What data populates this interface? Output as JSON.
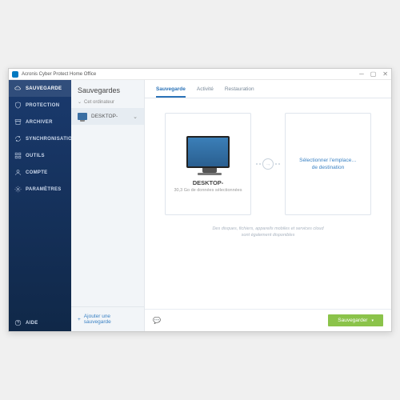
{
  "titlebar": {
    "title": "Acronis Cyber Protect Home Office"
  },
  "sidebar": {
    "items": [
      {
        "label": "SAUVEGARDE",
        "icon": "cloud"
      },
      {
        "label": "PROTECTION",
        "icon": "shield"
      },
      {
        "label": "ARCHIVER",
        "icon": "archive"
      },
      {
        "label": "SYNCHRONISATION",
        "icon": "sync"
      },
      {
        "label": "OUTILS",
        "icon": "grid"
      },
      {
        "label": "COMPTE",
        "icon": "user"
      },
      {
        "label": "PARAMÈTRES",
        "icon": "gear"
      }
    ],
    "help": {
      "label": "AIDE"
    }
  },
  "panel": {
    "heading": "Sauvegardes",
    "subheading": "Cet ordinateur",
    "device_name": "DESKTOP-",
    "add_label": "Ajouter une sauvegarde"
  },
  "tabs": [
    {
      "label": "Sauvegarde",
      "active": true
    },
    {
      "label": "Activité"
    },
    {
      "label": "Restauration"
    }
  ],
  "source_card": {
    "title": "DESKTOP-",
    "subtitle": "30,3 Go de données sélectionnées"
  },
  "dest_card": {
    "line1": "Sélectionner l'emplace…",
    "line2": "de destination"
  },
  "note": "Des disques, fichiers, appareils mobiles et services cloud sont également disponibles",
  "footer": {
    "save": "Sauvegarder"
  }
}
